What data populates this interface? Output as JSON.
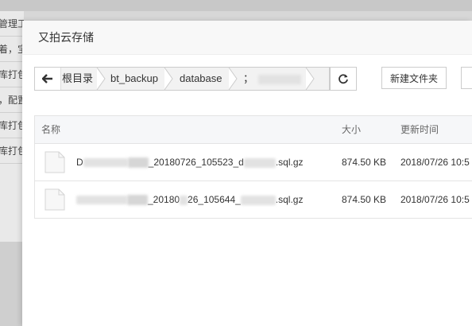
{
  "background": {
    "rows": [
      "管理工",
      "着，宝",
      "库打包",
      "，配置",
      "库打包",
      "库打包"
    ]
  },
  "dialog": {
    "title": "又拍云存储"
  },
  "breadcrumb": {
    "items": [
      "根目录",
      "bt_backup",
      "database",
      "；"
    ]
  },
  "toolbar": {
    "new_folder_label": "新建文件夹"
  },
  "table": {
    "headers": {
      "name": "名称",
      "size": "大小",
      "modified": "更新时间"
    },
    "rows": [
      {
        "name_prefix": "D",
        "name_mid": "_2018",
        "name_mid2": "0726_105523_d",
        "name_suffix": ".sql.gz",
        "size": "874.50 KB",
        "modified": "2018/07/26 10:5"
      },
      {
        "name_prefix": "",
        "name_mid": "_20180",
        "name_mid2": "26_105644_",
        "name_suffix": ".sql.gz",
        "size": "874.50 KB",
        "modified": "2018/07/26 10:5"
      }
    ]
  }
}
